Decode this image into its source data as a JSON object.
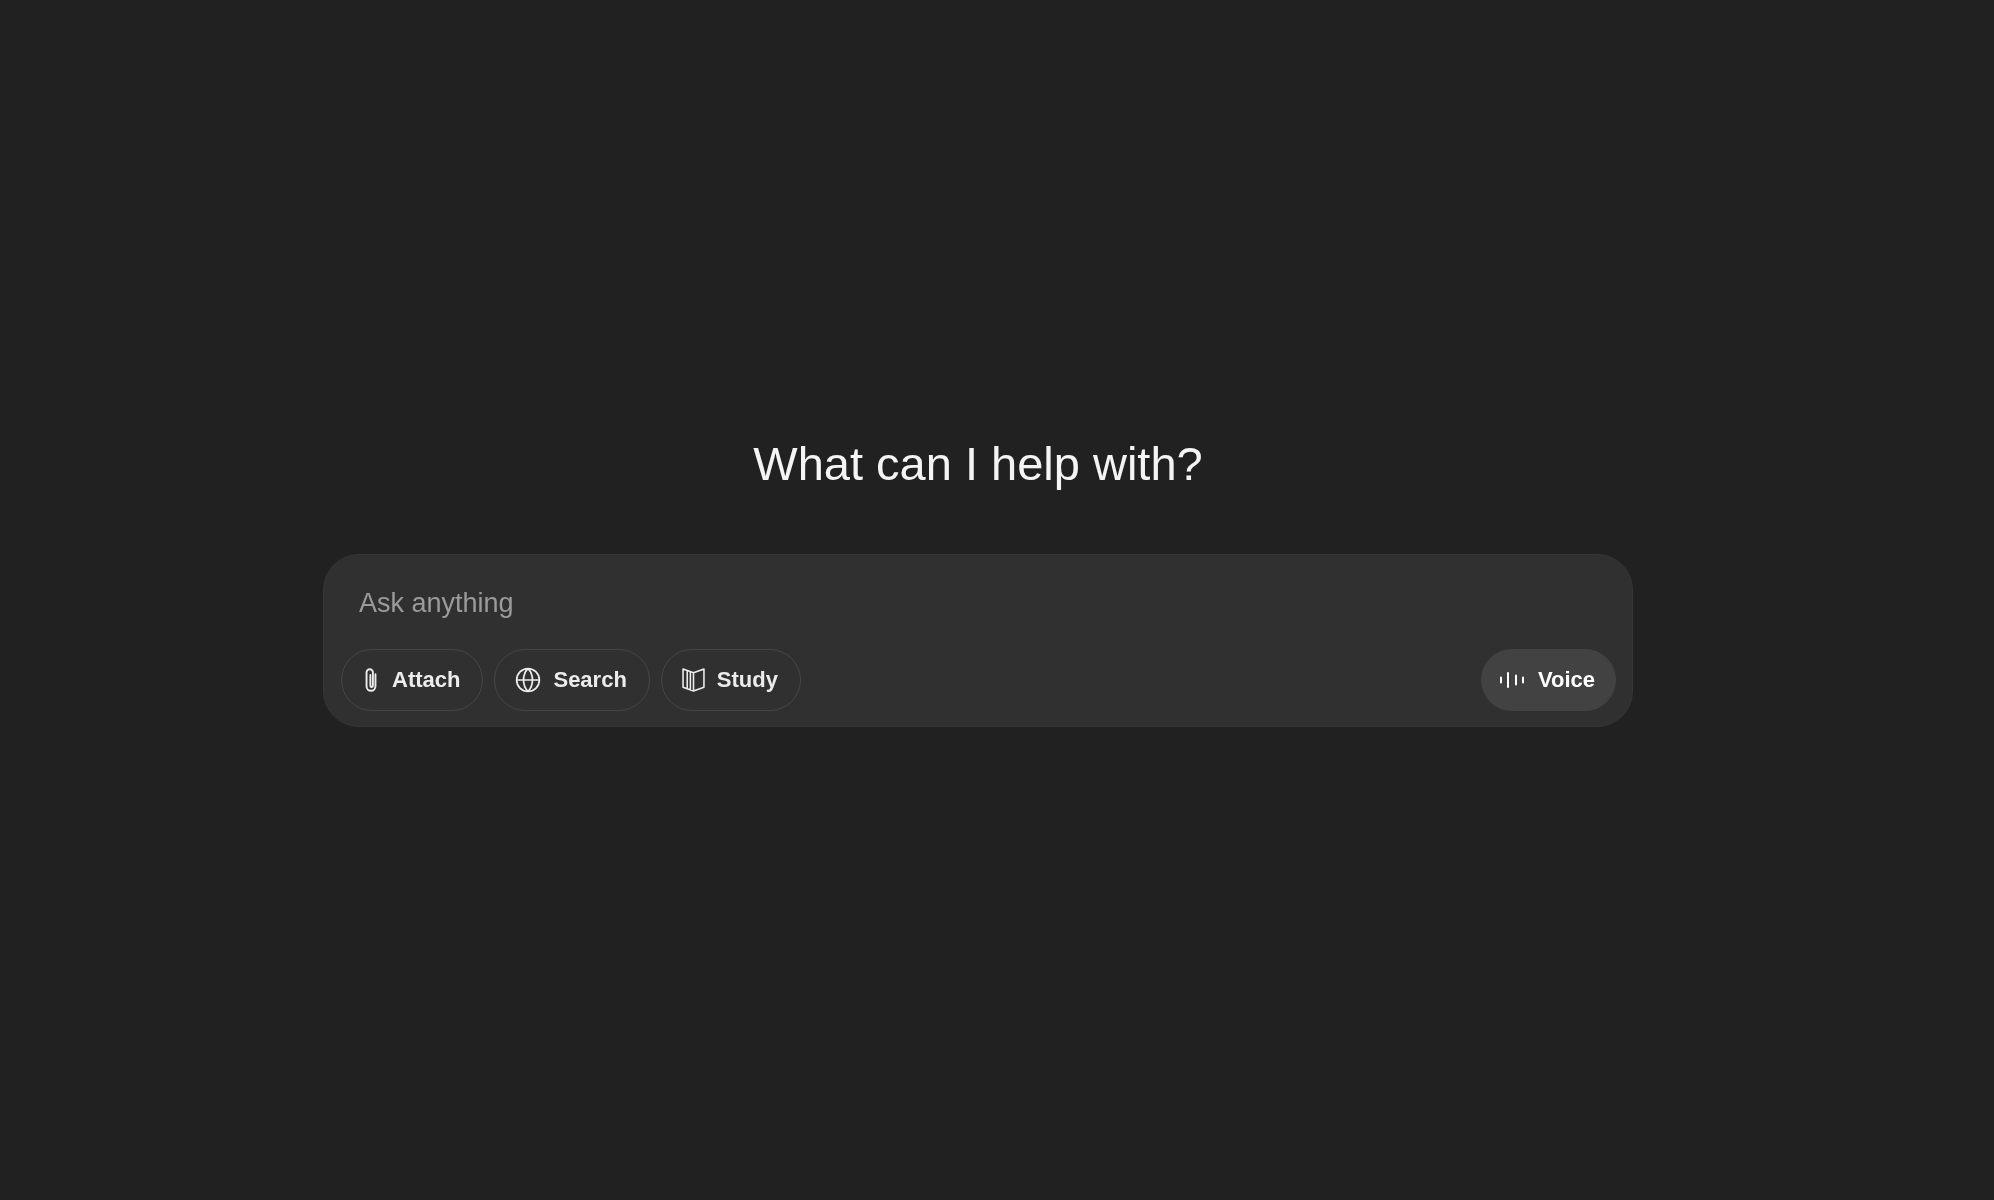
{
  "heading": "What can I help with?",
  "composer": {
    "placeholder": "Ask anything",
    "tools": [
      {
        "label": "Attach",
        "kind": "attach"
      },
      {
        "label": "Search",
        "kind": "search"
      },
      {
        "label": "Study",
        "kind": "study"
      }
    ],
    "voice_button": {
      "label": "Voice"
    }
  }
}
